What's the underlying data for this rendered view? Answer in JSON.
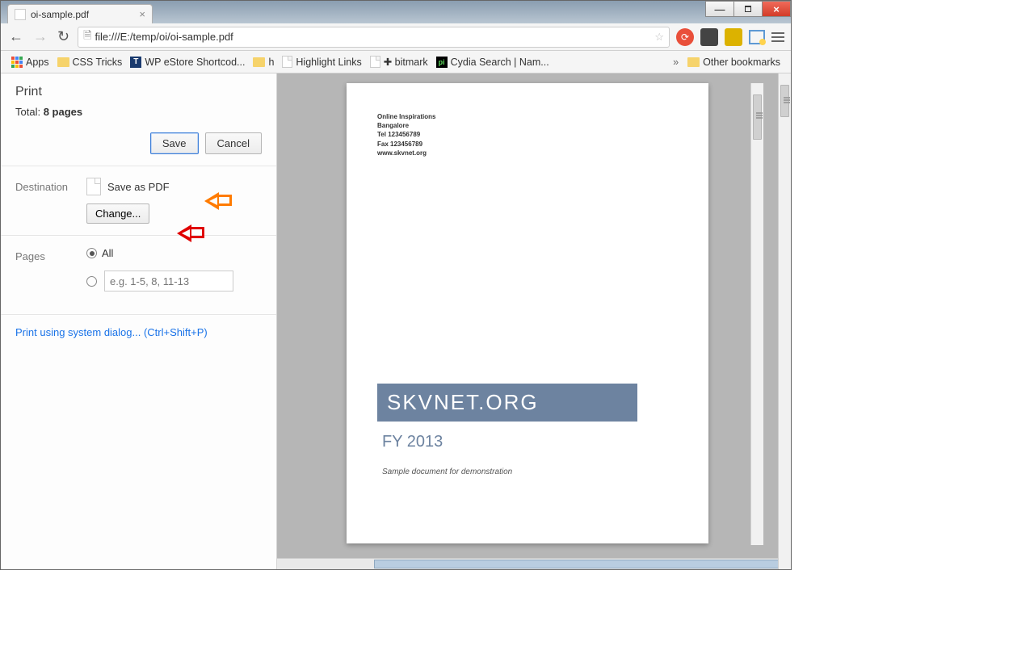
{
  "titlebar": {
    "min": "—",
    "close": "×"
  },
  "tab": {
    "title": "oi-sample.pdf"
  },
  "address": "file:///E:/temp/oi/oi-sample.pdf",
  "bookmarks": {
    "apps": "Apps",
    "items": [
      "CSS Tricks",
      "WP eStore Shortcod...",
      "h",
      "Highlight Links",
      "✚ bitmark",
      "Cydia Search | Nam..."
    ],
    "overflow": "»",
    "other": "Other bookmarks"
  },
  "print": {
    "title": "Print",
    "total_prefix": "Total: ",
    "total_value": "8 pages",
    "save": "Save",
    "cancel": "Cancel",
    "dest_label": "Destination",
    "dest_value": "Save as PDF",
    "change": "Change...",
    "pages_label": "Pages",
    "pages_all": "All",
    "pages_placeholder": "e.g. 1-5, 8, 11-13",
    "syslink": "Print using system dialog... (Ctrl+Shift+P)"
  },
  "doc": {
    "line1": "Online Inspirations",
    "line2": "Bangalore",
    "line3": "Tel 123456789",
    "line4": "Fax 123456789",
    "line5": "www.skvnet.org",
    "bar": "SKVNET.ORG",
    "fy": "FY 2013",
    "sub": "Sample document for demonstration"
  }
}
